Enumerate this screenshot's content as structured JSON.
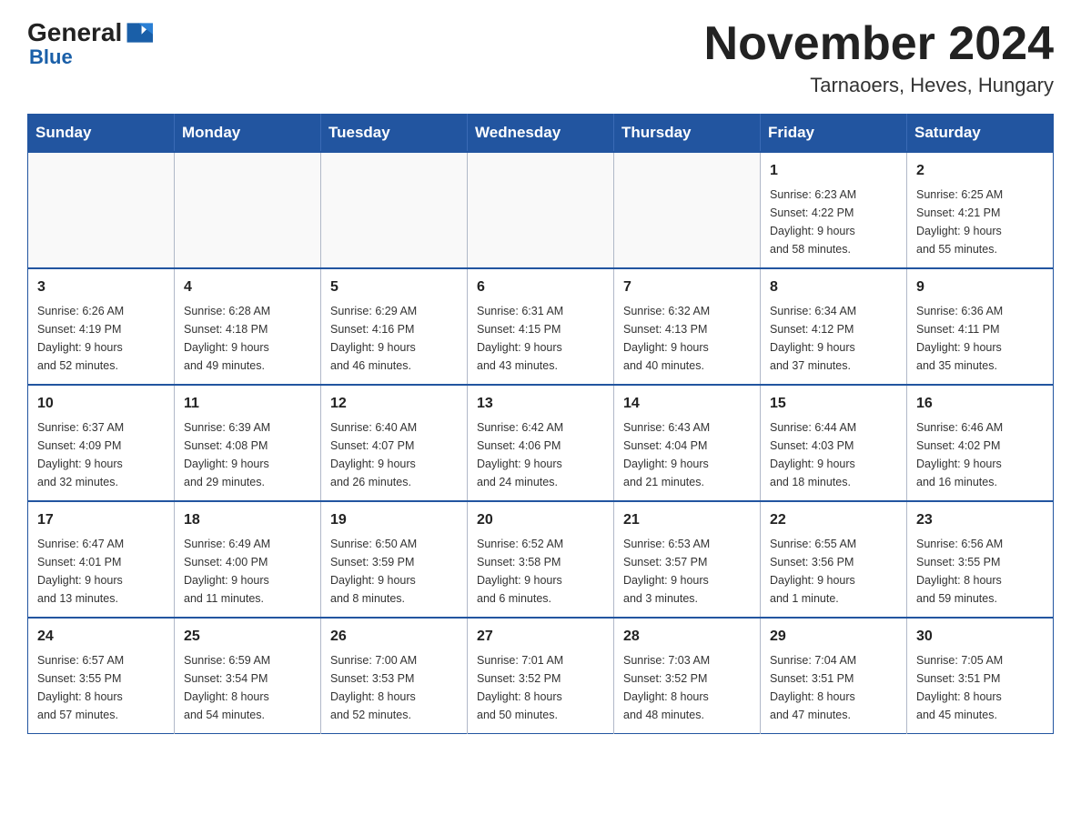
{
  "logo": {
    "general": "General",
    "blue": "Blue"
  },
  "title": "November 2024",
  "location": "Tarnaoers, Heves, Hungary",
  "weekdays": [
    "Sunday",
    "Monday",
    "Tuesday",
    "Wednesday",
    "Thursday",
    "Friday",
    "Saturday"
  ],
  "weeks": [
    [
      {
        "day": "",
        "info": ""
      },
      {
        "day": "",
        "info": ""
      },
      {
        "day": "",
        "info": ""
      },
      {
        "day": "",
        "info": ""
      },
      {
        "day": "",
        "info": ""
      },
      {
        "day": "1",
        "info": "Sunrise: 6:23 AM\nSunset: 4:22 PM\nDaylight: 9 hours\nand 58 minutes."
      },
      {
        "day": "2",
        "info": "Sunrise: 6:25 AM\nSunset: 4:21 PM\nDaylight: 9 hours\nand 55 minutes."
      }
    ],
    [
      {
        "day": "3",
        "info": "Sunrise: 6:26 AM\nSunset: 4:19 PM\nDaylight: 9 hours\nand 52 minutes."
      },
      {
        "day": "4",
        "info": "Sunrise: 6:28 AM\nSunset: 4:18 PM\nDaylight: 9 hours\nand 49 minutes."
      },
      {
        "day": "5",
        "info": "Sunrise: 6:29 AM\nSunset: 4:16 PM\nDaylight: 9 hours\nand 46 minutes."
      },
      {
        "day": "6",
        "info": "Sunrise: 6:31 AM\nSunset: 4:15 PM\nDaylight: 9 hours\nand 43 minutes."
      },
      {
        "day": "7",
        "info": "Sunrise: 6:32 AM\nSunset: 4:13 PM\nDaylight: 9 hours\nand 40 minutes."
      },
      {
        "day": "8",
        "info": "Sunrise: 6:34 AM\nSunset: 4:12 PM\nDaylight: 9 hours\nand 37 minutes."
      },
      {
        "day": "9",
        "info": "Sunrise: 6:36 AM\nSunset: 4:11 PM\nDaylight: 9 hours\nand 35 minutes."
      }
    ],
    [
      {
        "day": "10",
        "info": "Sunrise: 6:37 AM\nSunset: 4:09 PM\nDaylight: 9 hours\nand 32 minutes."
      },
      {
        "day": "11",
        "info": "Sunrise: 6:39 AM\nSunset: 4:08 PM\nDaylight: 9 hours\nand 29 minutes."
      },
      {
        "day": "12",
        "info": "Sunrise: 6:40 AM\nSunset: 4:07 PM\nDaylight: 9 hours\nand 26 minutes."
      },
      {
        "day": "13",
        "info": "Sunrise: 6:42 AM\nSunset: 4:06 PM\nDaylight: 9 hours\nand 24 minutes."
      },
      {
        "day": "14",
        "info": "Sunrise: 6:43 AM\nSunset: 4:04 PM\nDaylight: 9 hours\nand 21 minutes."
      },
      {
        "day": "15",
        "info": "Sunrise: 6:44 AM\nSunset: 4:03 PM\nDaylight: 9 hours\nand 18 minutes."
      },
      {
        "day": "16",
        "info": "Sunrise: 6:46 AM\nSunset: 4:02 PM\nDaylight: 9 hours\nand 16 minutes."
      }
    ],
    [
      {
        "day": "17",
        "info": "Sunrise: 6:47 AM\nSunset: 4:01 PM\nDaylight: 9 hours\nand 13 minutes."
      },
      {
        "day": "18",
        "info": "Sunrise: 6:49 AM\nSunset: 4:00 PM\nDaylight: 9 hours\nand 11 minutes."
      },
      {
        "day": "19",
        "info": "Sunrise: 6:50 AM\nSunset: 3:59 PM\nDaylight: 9 hours\nand 8 minutes."
      },
      {
        "day": "20",
        "info": "Sunrise: 6:52 AM\nSunset: 3:58 PM\nDaylight: 9 hours\nand 6 minutes."
      },
      {
        "day": "21",
        "info": "Sunrise: 6:53 AM\nSunset: 3:57 PM\nDaylight: 9 hours\nand 3 minutes."
      },
      {
        "day": "22",
        "info": "Sunrise: 6:55 AM\nSunset: 3:56 PM\nDaylight: 9 hours\nand 1 minute."
      },
      {
        "day": "23",
        "info": "Sunrise: 6:56 AM\nSunset: 3:55 PM\nDaylight: 8 hours\nand 59 minutes."
      }
    ],
    [
      {
        "day": "24",
        "info": "Sunrise: 6:57 AM\nSunset: 3:55 PM\nDaylight: 8 hours\nand 57 minutes."
      },
      {
        "day": "25",
        "info": "Sunrise: 6:59 AM\nSunset: 3:54 PM\nDaylight: 8 hours\nand 54 minutes."
      },
      {
        "day": "26",
        "info": "Sunrise: 7:00 AM\nSunset: 3:53 PM\nDaylight: 8 hours\nand 52 minutes."
      },
      {
        "day": "27",
        "info": "Sunrise: 7:01 AM\nSunset: 3:52 PM\nDaylight: 8 hours\nand 50 minutes."
      },
      {
        "day": "28",
        "info": "Sunrise: 7:03 AM\nSunset: 3:52 PM\nDaylight: 8 hours\nand 48 minutes."
      },
      {
        "day": "29",
        "info": "Sunrise: 7:04 AM\nSunset: 3:51 PM\nDaylight: 8 hours\nand 47 minutes."
      },
      {
        "day": "30",
        "info": "Sunrise: 7:05 AM\nSunset: 3:51 PM\nDaylight: 8 hours\nand 45 minutes."
      }
    ]
  ]
}
